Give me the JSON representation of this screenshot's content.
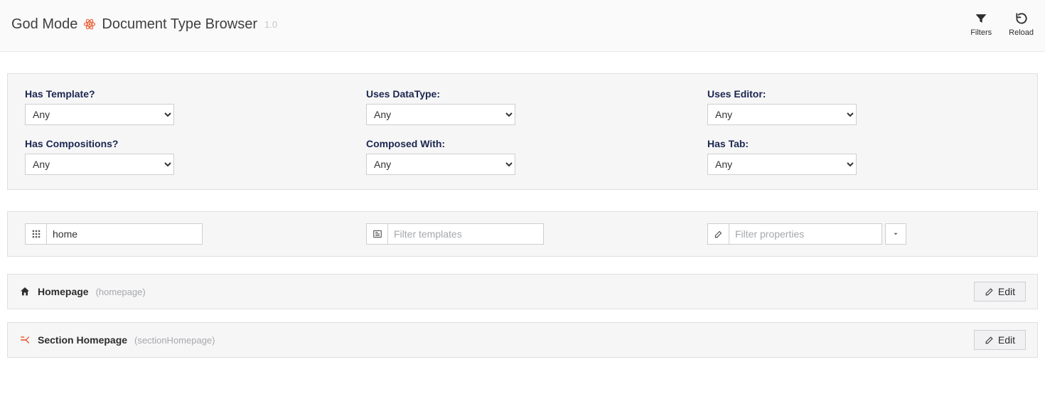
{
  "header": {
    "crumb": "God Mode",
    "title": "Document Type Browser",
    "version": "1.0",
    "actions": {
      "filters": "Filters",
      "reload": "Reload"
    }
  },
  "filterPanel": {
    "hasTemplate": {
      "label": "Has Template?",
      "value": "Any"
    },
    "usesDataType": {
      "label": "Uses DataType:",
      "value": "Any"
    },
    "usesEditor": {
      "label": "Uses Editor:",
      "value": "Any"
    },
    "hasCompositions": {
      "label": "Has Compositions?",
      "value": "Any"
    },
    "composedWith": {
      "label": "Composed With:",
      "value": "Any"
    },
    "hasTab": {
      "label": "Has Tab:",
      "value": "Any"
    }
  },
  "searchRow": {
    "name": {
      "value": "home",
      "placeholder": ""
    },
    "templates": {
      "value": "",
      "placeholder": "Filter templates"
    },
    "properties": {
      "value": "",
      "placeholder": "Filter properties"
    }
  },
  "results": [
    {
      "icon": "home",
      "name": "Homepage",
      "alias": "(homepage)",
      "edit_label": "Edit"
    },
    {
      "icon": "fork",
      "name": "Section Homepage",
      "alias": "(sectionHomepage)",
      "edit_label": "Edit"
    }
  ],
  "icons": {
    "atom": "atom-icon",
    "filter": "filter-icon",
    "reload": "reload-icon",
    "grid": "grid-icon",
    "newspaper": "newspaper-icon",
    "pencilbox": "edit-field-icon",
    "caret": "caret-down-icon",
    "home": "home-icon",
    "fork": "fork-icon",
    "pencil": "pencil-icon"
  }
}
